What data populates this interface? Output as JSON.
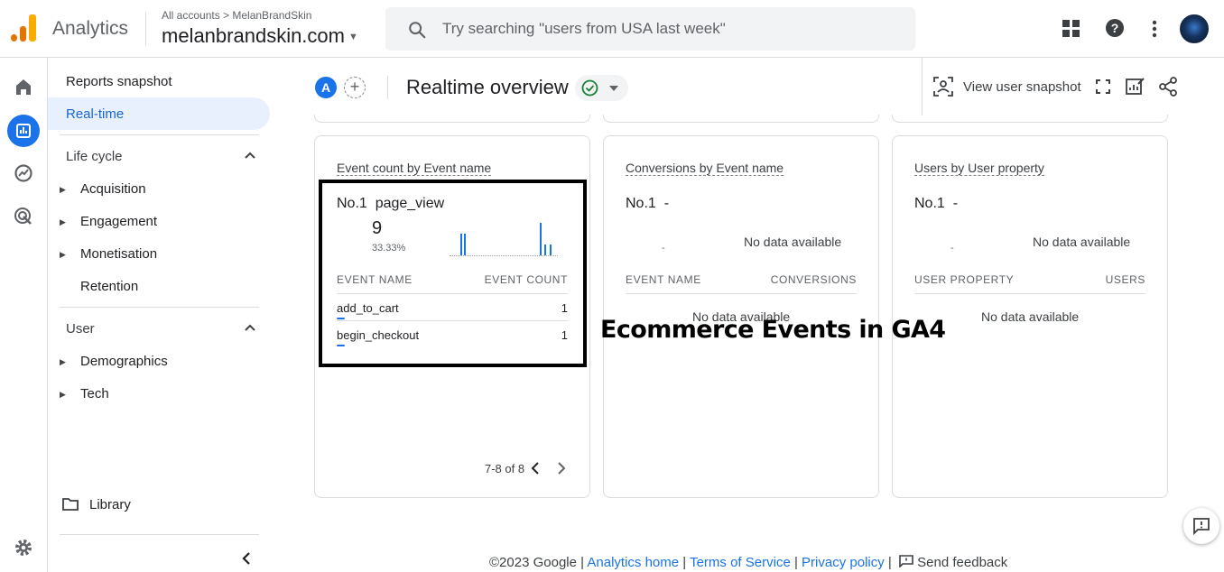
{
  "app": {
    "title": "Analytics"
  },
  "account": {
    "breadcrumb": "All accounts > MelanBrandSkin",
    "property": "melanbrandskin.com"
  },
  "search": {
    "placeholder": "Try searching \"users from USA last week\""
  },
  "nav": {
    "reports_snapshot": "Reports snapshot",
    "realtime": "Real-time",
    "lifecycle": {
      "label": "Life cycle",
      "items": [
        "Acquisition",
        "Engagement",
        "Monetisation",
        "Retention"
      ]
    },
    "user": {
      "label": "User",
      "items": [
        "Demographics",
        "Tech"
      ]
    },
    "library": "Library"
  },
  "header": {
    "comparison_badge": "A",
    "title": "Realtime overview",
    "view_snapshot": "View user snapshot"
  },
  "cards": [
    {
      "title": "Event count by Event name",
      "rank": "No.1",
      "top_item": "page_view",
      "top_value": "9",
      "top_pct": "33.33%",
      "col1": "EVENT NAME",
      "col2": "EVENT COUNT",
      "rows": [
        {
          "name": "add_to_cart",
          "value": "1"
        },
        {
          "name": "begin_checkout",
          "value": "1"
        }
      ],
      "pager": "7-8 of 8"
    },
    {
      "title": "Conversions by Event name",
      "rank": "No.1",
      "top_item": "-",
      "dash": "-",
      "nodata_top": "No data available",
      "col1": "EVENT NAME",
      "col2": "CONVERSIONS",
      "nodata_mid": "No data available"
    },
    {
      "title": "Users by User property",
      "rank": "No.1",
      "top_item": "-",
      "dash": "-",
      "nodata_top": "No data available",
      "col1": "USER PROPERTY",
      "col2": "USERS",
      "nodata_mid": "No data available"
    }
  ],
  "overlay": {
    "text": "Ecommerce Events in GA4"
  },
  "footer": {
    "copyright": "©2023 Google",
    "analytics_home": "Analytics home",
    "terms": "Terms of Service",
    "privacy": "Privacy policy",
    "feedback": "Send feedback",
    "sep": "|"
  },
  "colors": {
    "accent": "#1a73e8",
    "logo_orange": "#f9ab00",
    "logo_dark": "#e37400"
  },
  "icons": [
    "search-icon",
    "apps-grid-icon",
    "help-icon",
    "more-vert-icon",
    "home-icon",
    "reports-icon",
    "explore-icon",
    "advertising-icon",
    "settings-icon",
    "folder-icon",
    "collapse-chevron-icon",
    "check-circle-icon",
    "share-icon",
    "fullscreen-icon",
    "edit-insights-icon",
    "user-snapshot-icon",
    "feedback-icon"
  ]
}
